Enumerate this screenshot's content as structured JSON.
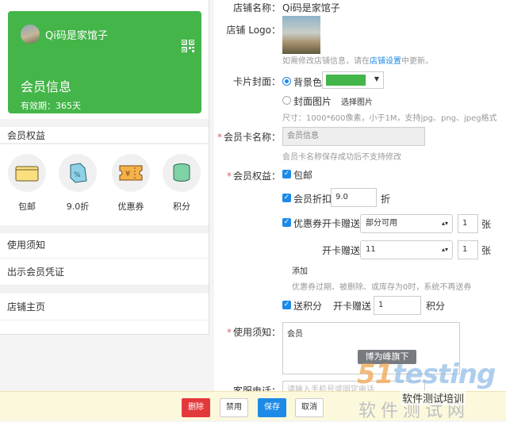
{
  "preview": {
    "shop_name": "Qi码是家馆子",
    "card_title": "会员信息",
    "validity": "有效期：365天",
    "benefits_title": "会员权益",
    "benefits": [
      {
        "label": "包邮",
        "icon": "wallet-icon"
      },
      {
        "label": "9.0折",
        "icon": "discount-tag-icon"
      },
      {
        "label": "优惠券",
        "icon": "coupon-icon"
      },
      {
        "label": "积分",
        "icon": "points-stack-icon"
      }
    ],
    "links": [
      "使用须知",
      "出示会员凭证",
      "店铺主页"
    ],
    "colors": {
      "card": "#44b549"
    }
  },
  "form": {
    "shop_name_label": "店铺名称：",
    "shop_name_value": "Qi码是家馆子",
    "logo_label": "店铺 Logo：",
    "logo_hint_pre": "如需修改店铺信息，请在",
    "logo_hint_link": "店铺设置",
    "logo_hint_post": "中更新。",
    "cover_label": "卡片封面：",
    "cover_bg_color": "背景色",
    "cover_image": "封面图片",
    "choose_image": "选择图片",
    "cover_hint": "尺寸：1000*600像素，小于1M，支持jpg、png、jpeg格式",
    "card_name_label": "会员卡名称：",
    "card_name_value": "会员信息",
    "card_name_hint": "会员卡名称保存成功后不支持修改",
    "benefits_label": "会员权益：",
    "free_shipping": "包邮",
    "member_discount": "会员折扣",
    "discount_value": "9.0",
    "discount_unit": "折",
    "coupon": "优惠券",
    "gift_on_open": "开卡赠送",
    "coupon_select_1": "部分可用",
    "coupon_qty_1": "1",
    "sheet_unit": "张",
    "coupon_select_2": "11",
    "coupon_qty_2": "1",
    "add_link": "添加",
    "coupon_hint": "优惠券过期、被删除、或库存为0时，系统不再送券",
    "send_points": "送积分",
    "points_value": "1",
    "points_unit": "积分",
    "notice_label": "使用须知：",
    "notice_value": "会员",
    "service_phone_label": "客服电话：",
    "service_phone_placeholder": "请输入手机号或固定电话"
  },
  "watermark": {
    "tag": "博为峰旗下",
    "logo_num": "51",
    "logo_text": "testing",
    "cn": "软件测试网",
    "wechat": "软件测试培训"
  },
  "actions": {
    "delete": "删除",
    "disable": "禁用",
    "save": "保存",
    "cancel": "取消"
  }
}
